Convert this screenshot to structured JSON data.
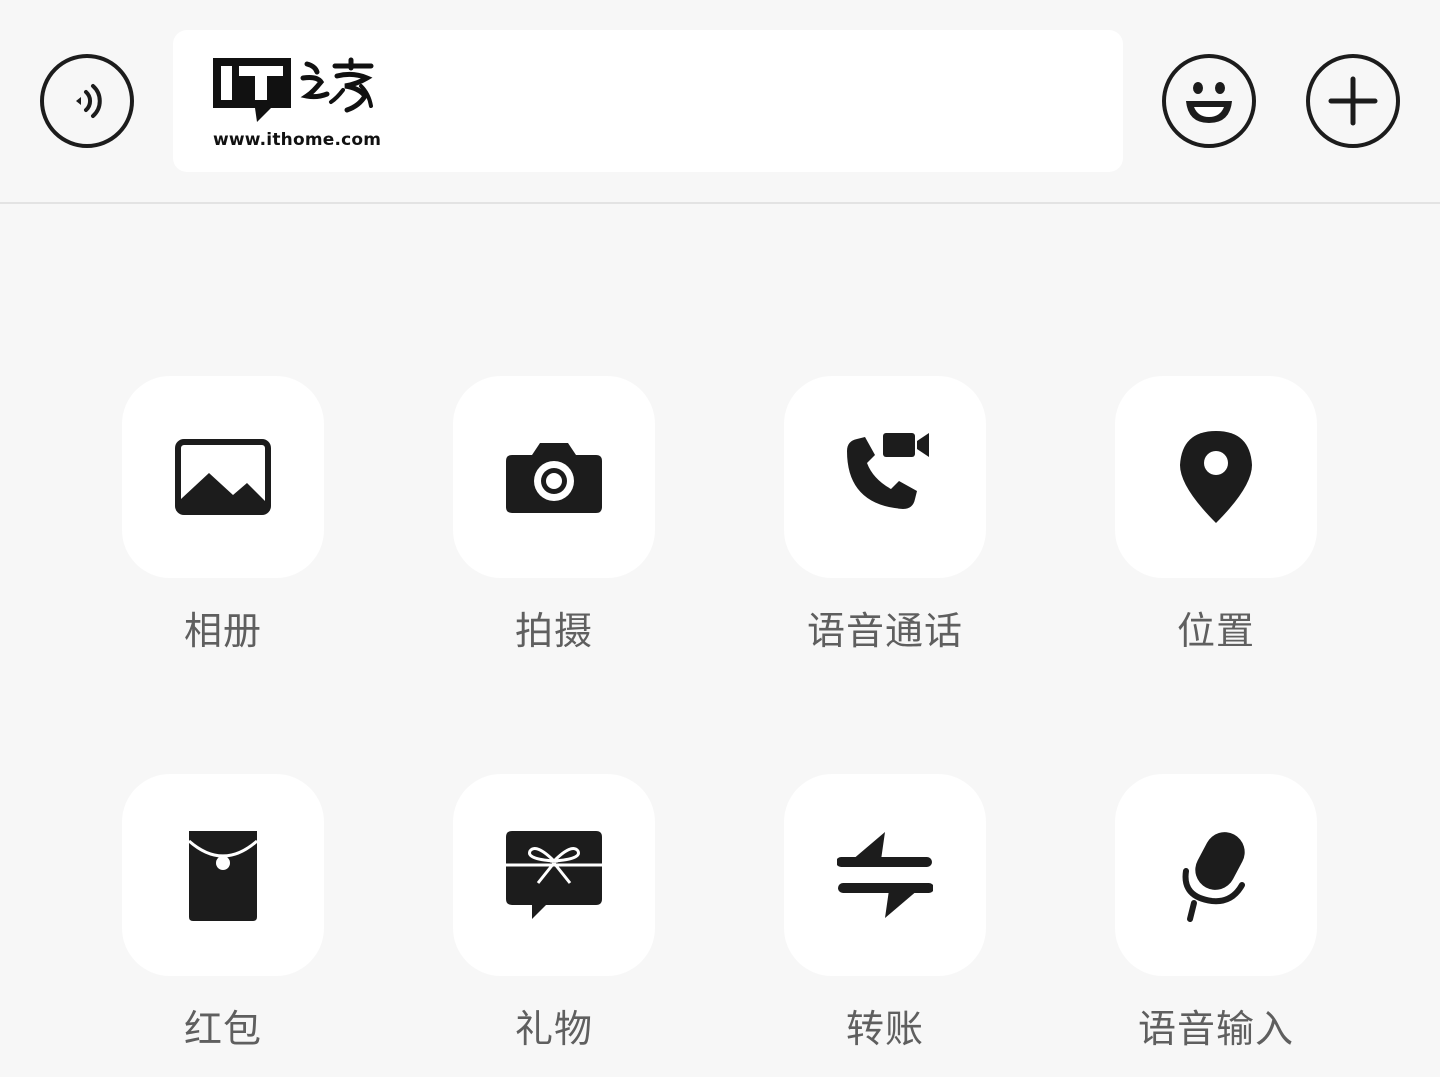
{
  "watermark": {
    "brand_mark": "IT之家",
    "url_text": "www.ithome.com"
  },
  "toolbar": {
    "left_icon": "voice-input-icon",
    "right_icons": [
      "emoji-icon",
      "plus-icon"
    ]
  },
  "features": [
    {
      "label": "相册",
      "icon": "photo-album-icon"
    },
    {
      "label": "拍摄",
      "icon": "camera-icon"
    },
    {
      "label": "语音通话",
      "icon": "voice-video-call-icon"
    },
    {
      "label": "位置",
      "icon": "location-pin-icon"
    },
    {
      "label": "红包",
      "icon": "red-packet-icon"
    },
    {
      "label": "礼物",
      "icon": "gift-icon"
    },
    {
      "label": "转账",
      "icon": "transfer-icon"
    },
    {
      "label": "语音输入",
      "icon": "microphone-icon"
    }
  ],
  "colors": {
    "background": "#f7f7f7",
    "tile": "#ffffff",
    "icon": "#1c1c1c",
    "label": "#5f5f5f"
  }
}
